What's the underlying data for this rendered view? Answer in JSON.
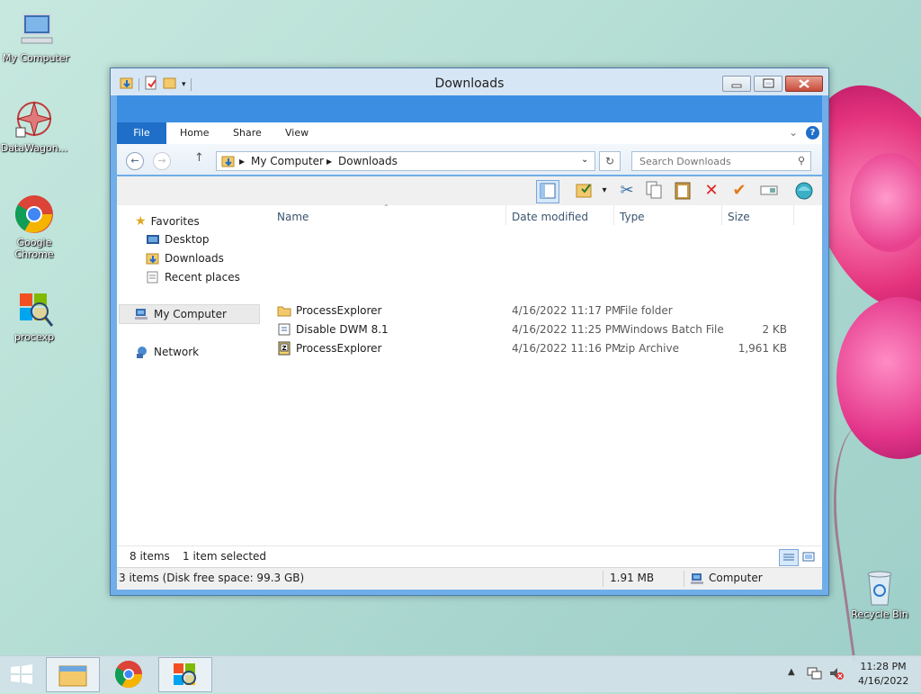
{
  "desktop": {
    "icons": [
      {
        "label": "My Computer"
      },
      {
        "label": "DataWagon..."
      },
      {
        "label": "Google Chrome"
      },
      {
        "label": "procexp"
      }
    ],
    "recycle_bin": "Recycle Bin"
  },
  "window": {
    "title": "Downloads",
    "tabs": [
      "File",
      "Home",
      "Share",
      "View"
    ],
    "address": {
      "crumbs": [
        "My Computer",
        "Downloads"
      ]
    },
    "search": {
      "placeholder": "Search Downloads"
    },
    "navigation": {
      "favorites": "Favorites",
      "favorite_items": [
        "Desktop",
        "Downloads",
        "Recent places"
      ],
      "computer": "My Computer",
      "network": "Network"
    },
    "columns": {
      "name": "Name",
      "date": "Date modified",
      "type": "Type",
      "size": "Size"
    },
    "files": [
      {
        "name": "ProcessExplorer",
        "date": "4/16/2022 11:17 PM",
        "type": "File folder",
        "size": "",
        "icon": "folder-icon"
      },
      {
        "name": "Disable DWM 8.1",
        "date": "4/16/2022 11:25 PM",
        "type": "Windows Batch File",
        "size": "2 KB",
        "icon": "batch-file-icon"
      },
      {
        "name": "ProcessExplorer",
        "date": "4/16/2022 11:16 PM",
        "type": "zip Archive",
        "size": "1,961 KB",
        "icon": "zip-icon"
      }
    ],
    "details": {
      "items": "8 items",
      "selected": "1 item selected"
    },
    "status": {
      "summary": "3 items (Disk free space: 99.3 GB)",
      "size": "1.91 MB",
      "location": "Computer"
    }
  },
  "taskbar": {
    "time": "11:28 PM",
    "date": "4/16/2022"
  },
  "colors": {
    "accent": "#1f6fc8",
    "ribbon": "#3c8ee3"
  }
}
